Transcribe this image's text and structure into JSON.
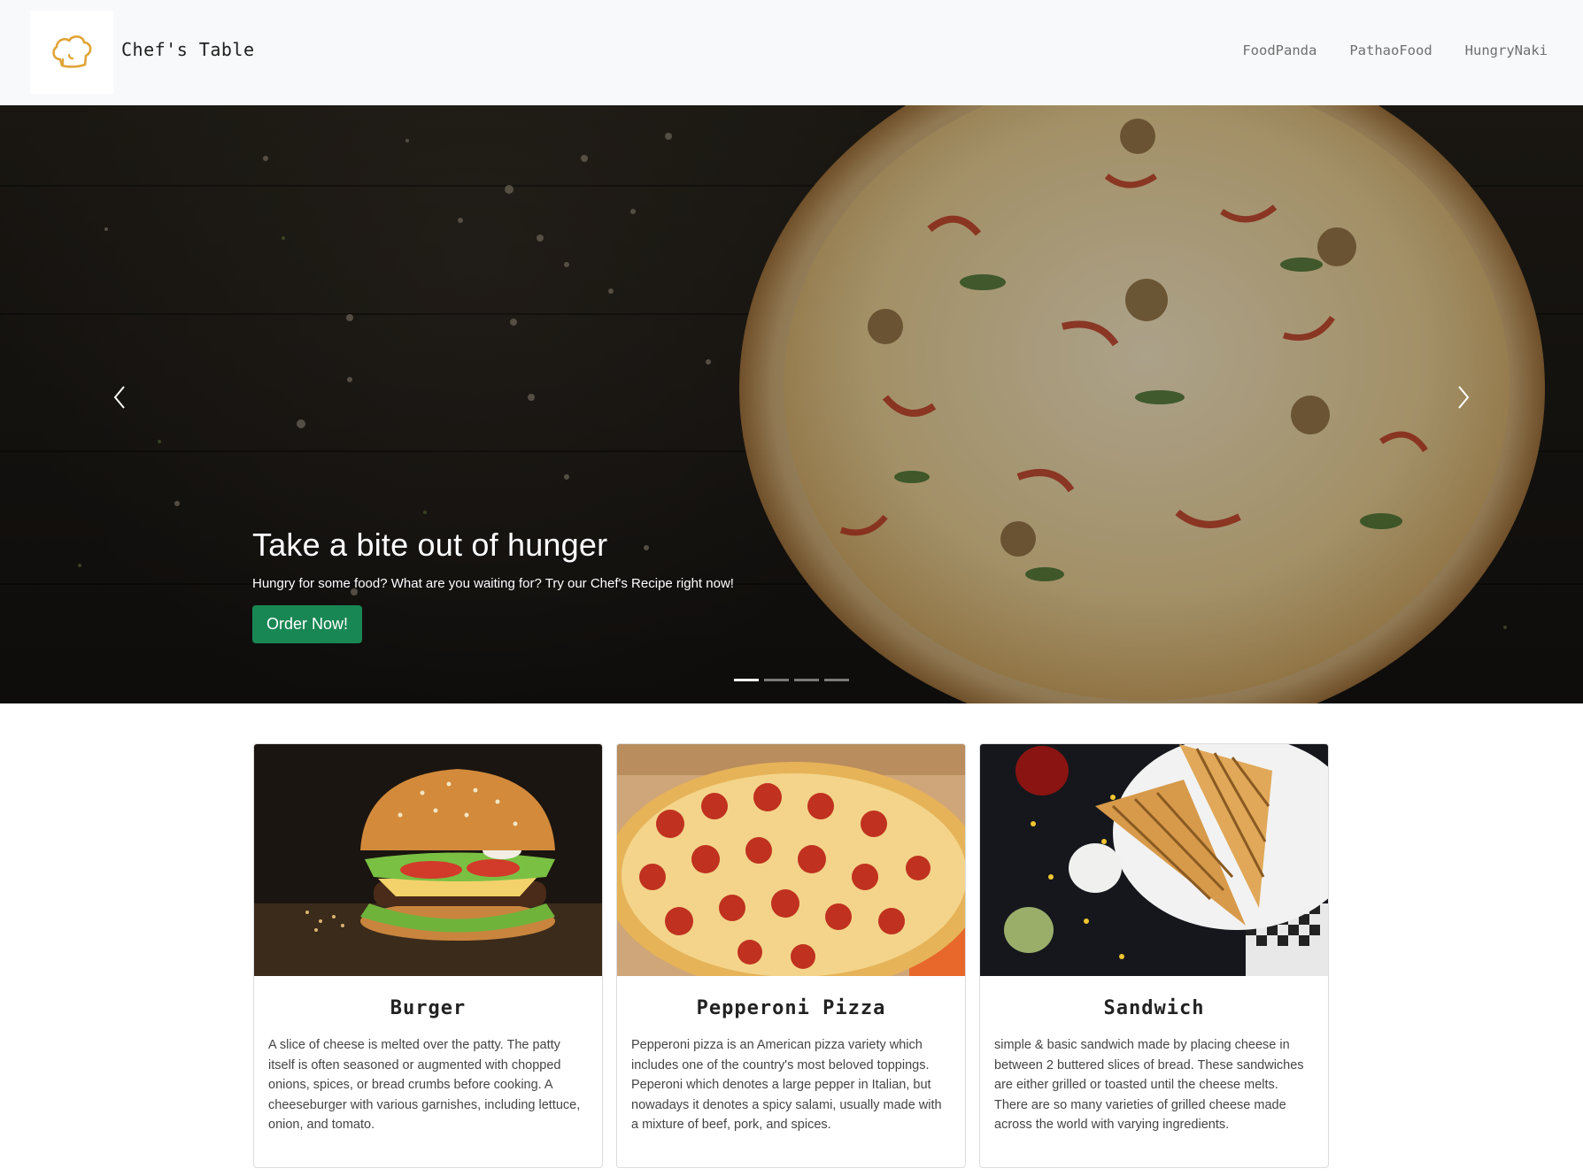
{
  "navbar": {
    "brand_name": "Chef's Table",
    "links": [
      "FoodPanda",
      "PathaoFood",
      "HungryNaki"
    ],
    "logo_icon": "chef-hat-icon",
    "logo_color": "#e0a437"
  },
  "carousel": {
    "title": "Take a bite out of hunger",
    "subtitle": "Hungry for some food? What are you waiting for? Try our Chef's Recipe right now!",
    "button_label": "Order Now!",
    "button_color": "#198754",
    "prev_icon": "chevron-left-icon",
    "next_icon": "chevron-right-icon",
    "slide_count": 4,
    "active_slide": 1
  },
  "cards": [
    {
      "title": "Burger",
      "image": "burger-image",
      "text": "A slice of cheese is melted over the patty. The patty itself is often seasoned or augmented with chopped onions, spices, or bread crumbs before cooking. A cheeseburger with various garnishes, including lettuce, onion, and tomato."
    },
    {
      "title": "Pepperoni Pizza",
      "image": "pepperoni-pizza-image",
      "text": "Pepperoni pizza is an American pizza variety which includes one of the country's most beloved toppings. Peperoni which denotes a large pepper in Italian, but nowadays it denotes a spicy salami, usually made with a mixture of beef, pork, and spices."
    },
    {
      "title": "Sandwich",
      "image": "sandwich-image",
      "text": "simple & basic sandwich made by placing cheese in between 2 buttered slices of bread. These sandwiches are either grilled or toasted until the cheese melts. There are so many varieties of grilled cheese made across the world with varying ingredients."
    }
  ]
}
